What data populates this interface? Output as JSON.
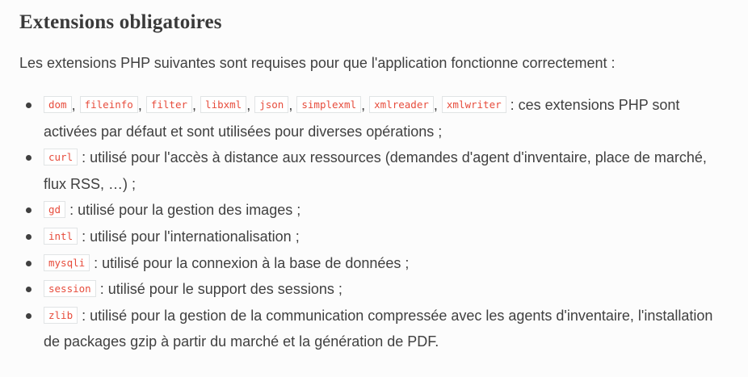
{
  "heading": "Extensions obligatoires",
  "intro": "Les extensions PHP suivantes sont requises pour que l'application fonctionne correctement :",
  "list": {
    "items": [
      {
        "codes": [
          "dom",
          "fileinfo",
          "filter",
          "libxml",
          "json",
          "simplexml",
          "xmlreader",
          "xmlwriter"
        ],
        "separator": ",",
        "text": " : ces extensions PHP sont activées par défaut et sont utilisées pour diverses opérations ;"
      },
      {
        "codes": [
          "curl"
        ],
        "text": " : utilisé pour l'accès à distance aux ressources (demandes d'agent d'inventaire, place de marché, flux RSS, …) ;"
      },
      {
        "codes": [
          "gd"
        ],
        "text": " : utilisé pour la gestion des images ;"
      },
      {
        "codes": [
          "intl"
        ],
        "text": " : utilisé pour l'internationalisation ;"
      },
      {
        "codes": [
          "mysqli"
        ],
        "text": " : utilisé pour la connexion à la base de données ;"
      },
      {
        "codes": [
          "session"
        ],
        "text": " : utilisé pour le support des sessions ;"
      },
      {
        "codes": [
          "zlib"
        ],
        "text": " : utilisé pour la gestion de la communication compressée avec les agents d'inventaire, l'installation de packages gzip à partir du marché et la génération de PDF."
      }
    ]
  },
  "colors": {
    "text": "#404040",
    "code_text": "#e74c3c",
    "code_border": "#e1e4e5",
    "background": "#fcfcfc"
  }
}
